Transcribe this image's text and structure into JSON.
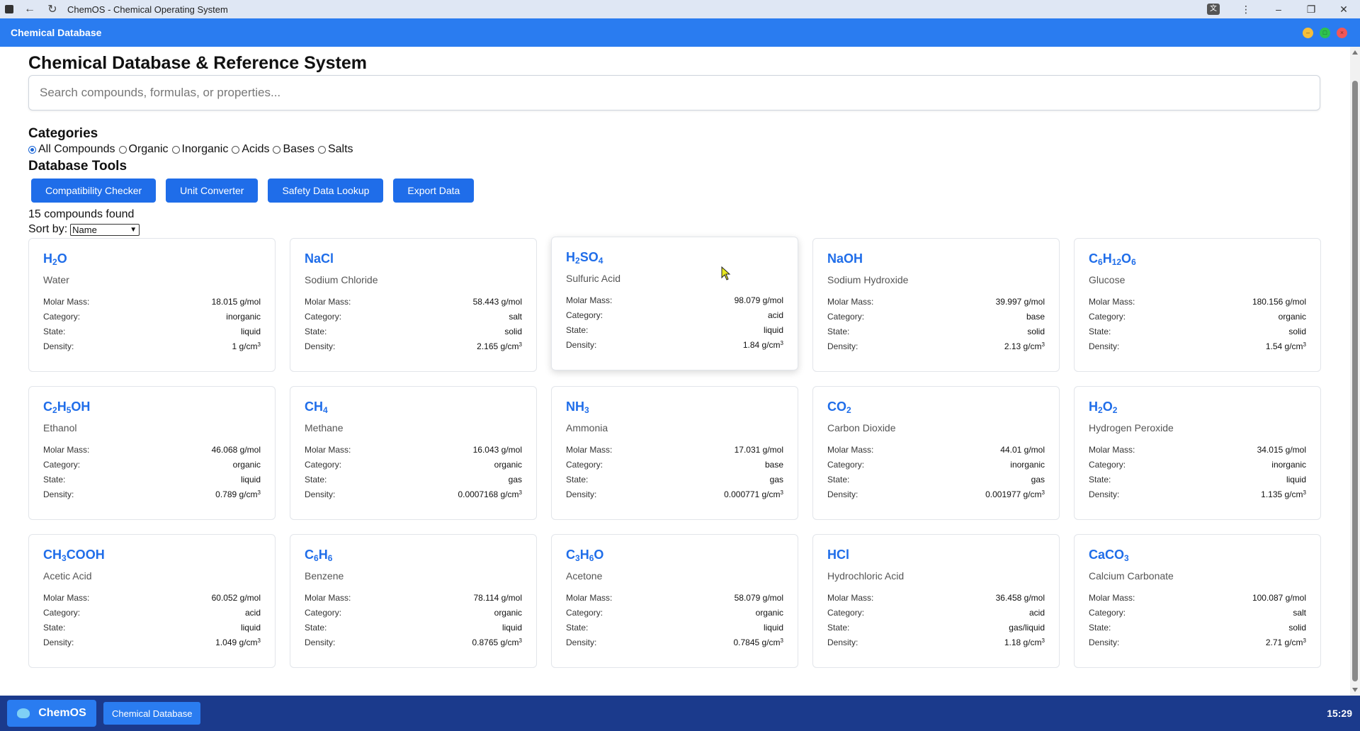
{
  "browser": {
    "title": "ChemOS - Chemical Operating System",
    "translate_icon": "translate-icon",
    "menu_icon": "⋮",
    "min_icon": "–",
    "max_icon": "❐",
    "close_icon": "✕"
  },
  "window": {
    "title": "Chemical Database"
  },
  "page": {
    "title": "Chemical Database & Reference System",
    "search_placeholder": "Search compounds, formulas, or properties...",
    "categories_heading": "Categories",
    "categories": [
      {
        "label": "All Compounds",
        "selected": true
      },
      {
        "label": "Organic",
        "selected": false
      },
      {
        "label": "Inorganic",
        "selected": false
      },
      {
        "label": "Acids",
        "selected": false
      },
      {
        "label": "Bases",
        "selected": false
      },
      {
        "label": "Salts",
        "selected": false
      }
    ],
    "tools_heading": "Database Tools",
    "tools": [
      "Compatibility Checker",
      "Unit Converter",
      "Safety Data Lookup",
      "Export Data"
    ],
    "count_text": "15 compounds found",
    "sort_label": "Sort by:",
    "sort_value": "Name"
  },
  "labels": {
    "molar_mass": "Molar Mass:",
    "category": "Category:",
    "state": "State:",
    "density": "Density:",
    "density_unit": "g/cm",
    "density_exp": "3"
  },
  "compounds": [
    {
      "formula_parts": [
        [
          "H",
          ""
        ],
        [
          "2",
          "sub"
        ],
        [
          "O",
          ""
        ]
      ],
      "name": "Water",
      "molar_mass": "18.015 g/mol",
      "category": "inorganic",
      "state": "liquid",
      "density": "1"
    },
    {
      "formula_parts": [
        [
          "NaCl",
          ""
        ]
      ],
      "name": "Sodium Chloride",
      "molar_mass": "58.443 g/mol",
      "category": "salt",
      "state": "solid",
      "density": "2.165"
    },
    {
      "formula_parts": [
        [
          "H",
          ""
        ],
        [
          "2",
          "sub"
        ],
        [
          "SO",
          ""
        ],
        [
          "4",
          "sub"
        ]
      ],
      "name": "Sulfuric Acid",
      "molar_mass": "98.079 g/mol",
      "category": "acid",
      "state": "liquid",
      "density": "1.84"
    },
    {
      "formula_parts": [
        [
          "NaOH",
          ""
        ]
      ],
      "name": "Sodium Hydroxide",
      "molar_mass": "39.997 g/mol",
      "category": "base",
      "state": "solid",
      "density": "2.13"
    },
    {
      "formula_parts": [
        [
          "C",
          ""
        ],
        [
          "6",
          "sub"
        ],
        [
          "H",
          ""
        ],
        [
          "12",
          "sub"
        ],
        [
          "O",
          ""
        ],
        [
          "6",
          "sub"
        ]
      ],
      "name": "Glucose",
      "molar_mass": "180.156 g/mol",
      "category": "organic",
      "state": "solid",
      "density": "1.54"
    },
    {
      "formula_parts": [
        [
          "C",
          ""
        ],
        [
          "2",
          "sub"
        ],
        [
          "H",
          ""
        ],
        [
          "5",
          "sub"
        ],
        [
          "OH",
          ""
        ]
      ],
      "name": "Ethanol",
      "molar_mass": "46.068 g/mol",
      "category": "organic",
      "state": "liquid",
      "density": "0.789"
    },
    {
      "formula_parts": [
        [
          "CH",
          ""
        ],
        [
          "4",
          "sub"
        ]
      ],
      "name": "Methane",
      "molar_mass": "16.043 g/mol",
      "category": "organic",
      "state": "gas",
      "density": "0.0007168"
    },
    {
      "formula_parts": [
        [
          "NH",
          ""
        ],
        [
          "3",
          "sub"
        ]
      ],
      "name": "Ammonia",
      "molar_mass": "17.031 g/mol",
      "category": "base",
      "state": "gas",
      "density": "0.000771"
    },
    {
      "formula_parts": [
        [
          "CO",
          ""
        ],
        [
          "2",
          "sub"
        ]
      ],
      "name": "Carbon Dioxide",
      "molar_mass": "44.01 g/mol",
      "category": "inorganic",
      "state": "gas",
      "density": "0.001977"
    },
    {
      "formula_parts": [
        [
          "H",
          ""
        ],
        [
          "2",
          "sub"
        ],
        [
          "O",
          ""
        ],
        [
          "2",
          "sub"
        ]
      ],
      "name": "Hydrogen Peroxide",
      "molar_mass": "34.015 g/mol",
      "category": "inorganic",
      "state": "liquid",
      "density": "1.135"
    },
    {
      "formula_parts": [
        [
          "CH",
          ""
        ],
        [
          "3",
          "sub"
        ],
        [
          "COOH",
          ""
        ]
      ],
      "name": "Acetic Acid",
      "molar_mass": "60.052 g/mol",
      "category": "acid",
      "state": "liquid",
      "density": "1.049"
    },
    {
      "formula_parts": [
        [
          "C",
          ""
        ],
        [
          "6",
          "sub"
        ],
        [
          "H",
          ""
        ],
        [
          "6",
          "sub"
        ]
      ],
      "name": "Benzene",
      "molar_mass": "78.114 g/mol",
      "category": "organic",
      "state": "liquid",
      "density": "0.8765"
    },
    {
      "formula_parts": [
        [
          "C",
          ""
        ],
        [
          "3",
          "sub"
        ],
        [
          "H",
          ""
        ],
        [
          "6",
          "sub"
        ],
        [
          "O",
          ""
        ]
      ],
      "name": "Acetone",
      "molar_mass": "58.079 g/mol",
      "category": "organic",
      "state": "liquid",
      "density": "0.7845"
    },
    {
      "formula_parts": [
        [
          "HCl",
          ""
        ]
      ],
      "name": "Hydrochloric Acid",
      "molar_mass": "36.458 g/mol",
      "category": "acid",
      "state": "gas/liquid",
      "density": "1.18"
    },
    {
      "formula_parts": [
        [
          "CaCO",
          ""
        ],
        [
          "3",
          "sub"
        ]
      ],
      "name": "Calcium Carbonate",
      "molar_mass": "100.087 g/mol",
      "category": "salt",
      "state": "solid",
      "density": "2.71"
    }
  ],
  "taskbar": {
    "start_label": "ChemOS",
    "start_icon": "flask-icon",
    "task_label": "Chemical Database",
    "clock": "15:29"
  },
  "colors": {
    "accent": "#2a7cf0",
    "button": "#1f6de9",
    "taskbar": "#1b3a8c"
  }
}
